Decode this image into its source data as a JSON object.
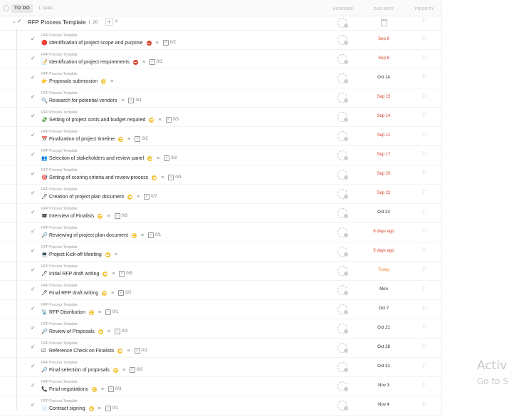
{
  "header": {
    "status": "TO DO",
    "task_count": "1 TASK",
    "columns": {
      "assignee": "ASSIGNEE",
      "due_date": "DUE DATE",
      "priority": "PRIORITY"
    }
  },
  "parent": {
    "name": "RFP Process Template",
    "subtask_count": "20",
    "add_label": "+"
  },
  "colors": {
    "overdue": "#d9412e",
    "today": "#e8883a",
    "normal": "#2b2b2b",
    "priority_urgent": "#d9412e",
    "priority_normal": "#f2c12e"
  },
  "tasks": [
    {
      "parent": "RFP Process Template",
      "emoji": "🔴",
      "name": "Identification of project scope and purpose",
      "priority": "red",
      "checklist": "0/2",
      "due": "Sep 8",
      "due_status": "overdue"
    },
    {
      "parent": "RFP Process Template",
      "emoji": "📝",
      "name": "Identification of project requirements",
      "priority": "red",
      "checklist": "0/2",
      "due": "Sep 8",
      "due_status": "overdue"
    },
    {
      "parent": "RFP Process Template",
      "emoji": "👉",
      "name": "Proposals submission",
      "priority": "yellow",
      "checklist": "",
      "due": "Oct 14",
      "due_status": "normal"
    },
    {
      "parent": "RFP Process Template",
      "emoji": "🔍",
      "name": "Research for potential vendors",
      "priority": "",
      "checklist": "0/1",
      "due": "Sep 15",
      "due_status": "overdue"
    },
    {
      "parent": "RFP Process Template",
      "emoji": "💸",
      "name": "Setting of project costs and budget required",
      "priority": "yellow",
      "checklist": "0/3",
      "due": "Sep 14",
      "due_status": "overdue"
    },
    {
      "parent": "RFP Process Template",
      "emoji": "📅",
      "name": "Finalization of project timeline",
      "priority": "yellow",
      "checklist": "0/2",
      "due": "Sep 11",
      "due_status": "overdue"
    },
    {
      "parent": "RFP Process Template",
      "emoji": "👥",
      "name": "Selection of stakeholders and review panel",
      "priority": "yellow",
      "checklist": "0/2",
      "due": "Sep 17",
      "due_status": "overdue"
    },
    {
      "parent": "RFP Process Template",
      "emoji": "🎯",
      "name": "Setting of scoring criteria and review process",
      "priority": "yellow",
      "checklist": "0/3",
      "due": "Sep 20",
      "due_status": "overdue"
    },
    {
      "parent": "RFP Process Template",
      "emoji": "🖊",
      "name": "Creation of project plan document",
      "priority": "yellow",
      "checklist": "0/7",
      "due": "Sep 22",
      "due_status": "overdue"
    },
    {
      "parent": "RFP Process Template",
      "emoji": "☎",
      "name": "Interview of Finalists",
      "priority": "yellow",
      "checklist": "0/3",
      "due": "Oct 24",
      "due_status": "normal"
    },
    {
      "parent": "RFP Process Template",
      "emoji": "🔎",
      "name": "Reviewing of project plan document",
      "priority": "yellow",
      "checklist": "0/1",
      "due": "6 days ago",
      "due_status": "overdue"
    },
    {
      "parent": "RFP Process Template",
      "emoji": "💻",
      "name": "Project Kick-off Meeting",
      "priority": "yellow",
      "checklist": "",
      "due": "5 days ago",
      "due_status": "overdue"
    },
    {
      "parent": "RFP Process Template",
      "emoji": "🖊",
      "name": "Initial RFP draft writing",
      "priority": "yellow",
      "checklist": "0/9",
      "due": "Today",
      "due_status": "today"
    },
    {
      "parent": "RFP Process Template",
      "emoji": "🖊",
      "name": "Final RFP draft writing",
      "priority": "yellow",
      "checklist": "0/2",
      "due": "Mon",
      "due_status": "normal"
    },
    {
      "parent": "RFP Process Template",
      "emoji": "📡",
      "name": "RFP Distribution",
      "priority": "yellow",
      "checklist": "0/1",
      "due": "Oct 7",
      "due_status": "normal"
    },
    {
      "parent": "RFP Process Template",
      "emoji": "🔎",
      "name": "Review of Proposals",
      "priority": "yellow",
      "checklist": "0/3",
      "due": "Oct 21",
      "due_status": "normal"
    },
    {
      "parent": "RFP Process Template",
      "emoji": "☑",
      "name": "Reference Check on Finalists",
      "priority": "yellow",
      "checklist": "0/1",
      "due": "Oct 28",
      "due_status": "normal"
    },
    {
      "parent": "RFP Process Template",
      "emoji": "🔎",
      "name": "Final selection of proposals",
      "priority": "yellow",
      "checklist": "0/3",
      "due": "Oct 31",
      "due_status": "normal"
    },
    {
      "parent": "RFP Process Template",
      "emoji": "📞",
      "name": "Final negotiations",
      "priority": "yellow",
      "checklist": "0/3",
      "due": "Nov 3",
      "due_status": "normal"
    },
    {
      "parent": "RFP Process Template",
      "emoji": "📄",
      "name": "Contract signing",
      "priority": "yellow",
      "checklist": "0/1",
      "due": "Nov 4",
      "due_status": "normal"
    }
  ],
  "watermark": {
    "line1": "Activ",
    "line2": "Go to S"
  }
}
